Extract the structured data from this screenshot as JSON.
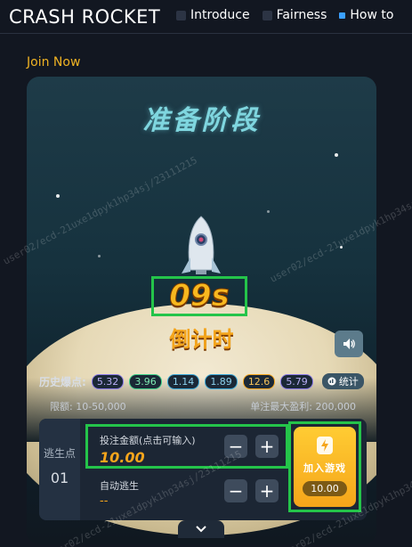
{
  "header": {
    "app_title": "CRASH ROCKET",
    "tabs": [
      {
        "label": "Introduce"
      },
      {
        "label": "Fairness"
      },
      {
        "label": "How to"
      }
    ]
  },
  "join_link": "Join Now",
  "game": {
    "phase_title": "准备阶段",
    "countdown": "09s",
    "countdown_label": "倒计时",
    "sound_icon": "speaker-icon",
    "history": {
      "label": "历史爆点:",
      "values": [
        {
          "value": "5.32",
          "color": "#8a7ae8"
        },
        {
          "value": "3.96",
          "color": "#3ed18a"
        },
        {
          "value": "1.14",
          "color": "#3aa8d8"
        },
        {
          "value": "1.89",
          "color": "#3aa8d8"
        },
        {
          "value": "12.6",
          "color": "#f4a51c"
        },
        {
          "value": "5.79",
          "color": "#8a7ae8"
        }
      ],
      "stats_label": "统计"
    },
    "limit_text": "限额: 10-50,000",
    "max_win_text": "单注最大盈利: 200,000"
  },
  "bet_panel": {
    "escape_label": "逃生点",
    "escape_number": "01",
    "bet_amount_label": "投注金额(点击可输入)",
    "bet_amount_value": "10.00",
    "auto_escape_label": "自动逃生",
    "auto_escape_value": "--",
    "minus": "−",
    "plus": "+",
    "join_button_label": "加入游戏",
    "join_button_amount": "10.00"
  },
  "watermark": "user02/ecd-21uxe1dpyk1hp34sj/23111215",
  "colors": {
    "accent": "#f4a51c",
    "highlight_box": "#24c44a",
    "background": "#121721"
  }
}
